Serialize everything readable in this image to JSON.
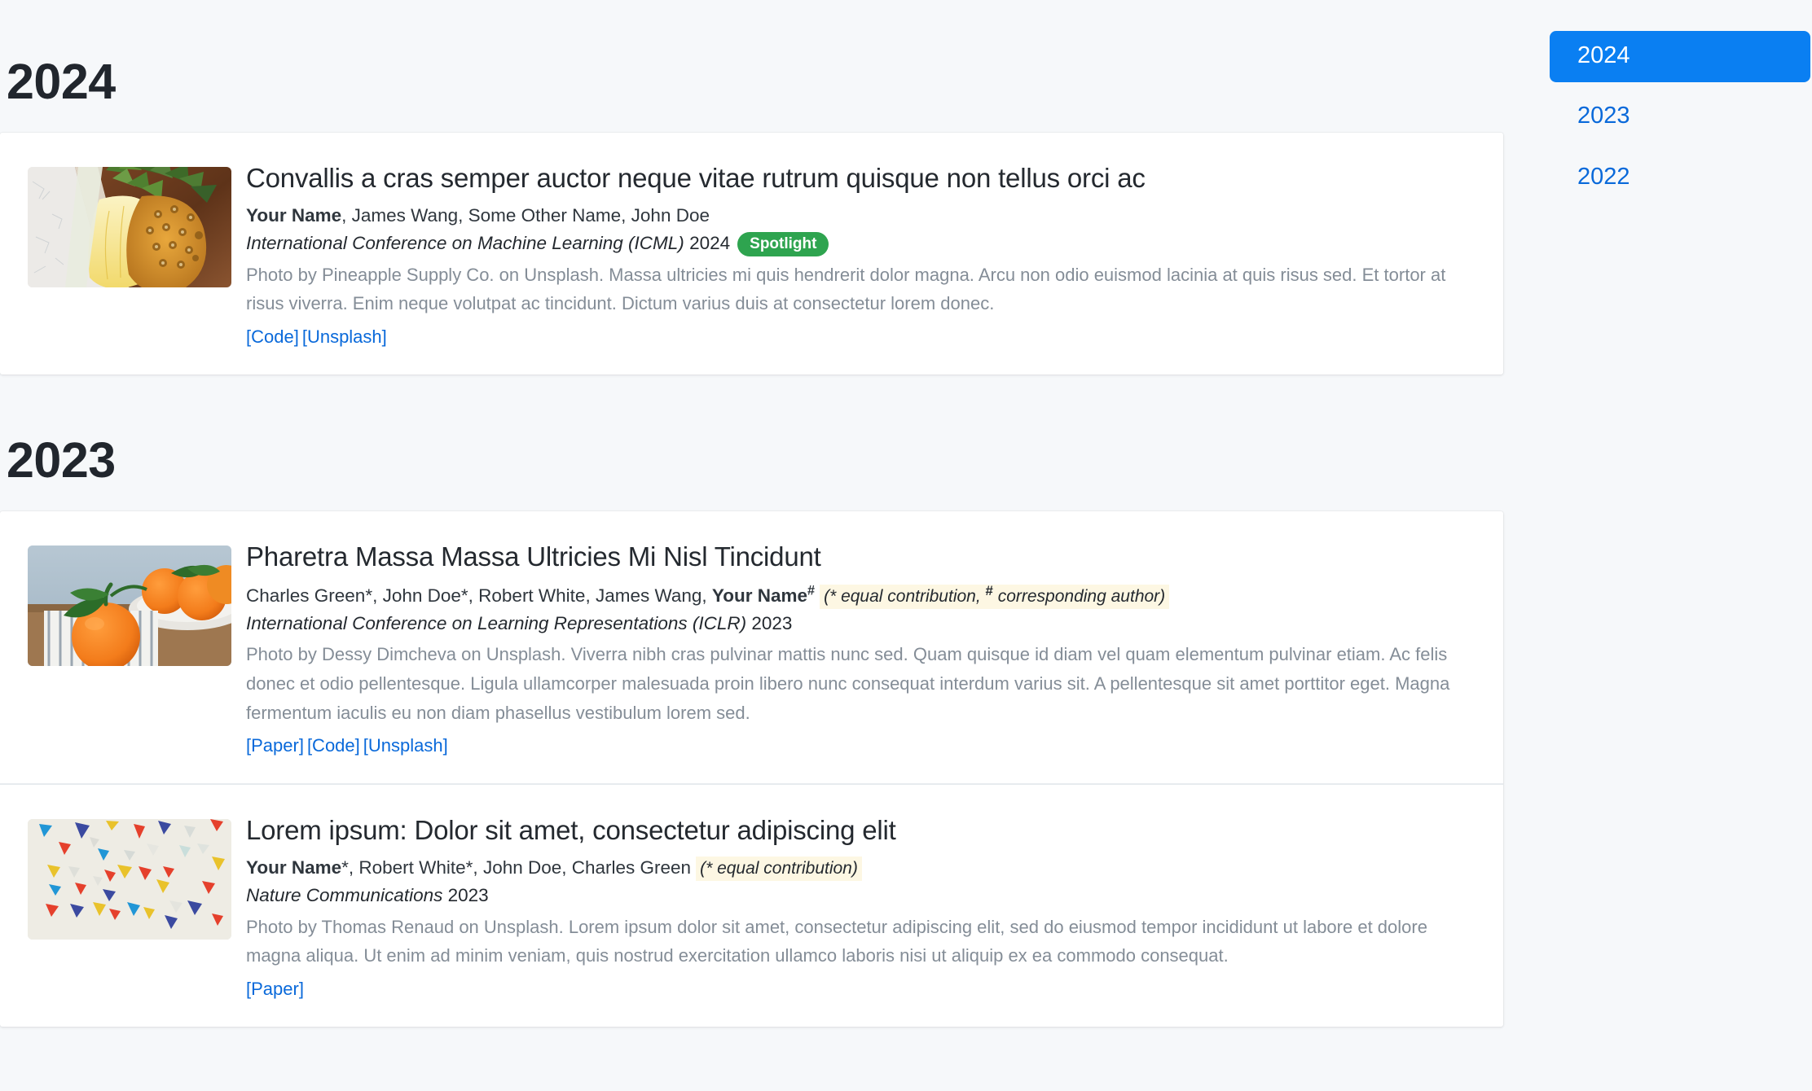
{
  "sidebar": {
    "items": [
      {
        "label": "2024",
        "active": true
      },
      {
        "label": "2023",
        "active": false
      },
      {
        "label": "2022",
        "active": false
      }
    ]
  },
  "sections": [
    {
      "year": "2024",
      "publications": [
        {
          "thumbnail": "pineapple-photo",
          "title": "Convallis a cras semper auctor neque vitae rutrum quisque non tellus orci ac",
          "authors_bold": "Your Name",
          "authors_rest": ", James Wang, Some Other Name, John Doe",
          "note": "",
          "venue": "International Conference on Machine Learning (ICML)",
          "venue_year": "2024",
          "badge": "Spotlight",
          "abstract": "Photo by Pineapple Supply Co. on Unsplash. Massa ultricies mi quis hendrerit dolor magna. Arcu non odio euismod lacinia at quis risus sed. Et tortor at risus viverra. Enim neque volutpat ac tincidunt. Dictum varius duis at consectetur lorem donec.",
          "links": [
            "[Code]",
            "[Unsplash]"
          ]
        }
      ]
    },
    {
      "year": "2023",
      "publications": [
        {
          "thumbnail": "oranges-photo",
          "title": "Pharetra Massa Massa Ultricies Mi Nisl Tincidunt",
          "authors_pre": "Charles Green*, John Doe*, Robert White, James Wang, ",
          "authors_bold": "Your Name",
          "authors_sup": "#",
          "note_a": "(* equal contribution, ",
          "note_sup": "#",
          "note_b": " corresponding author)",
          "venue": "International Conference on Learning Representations (ICLR)",
          "venue_year": "2023",
          "badge": "",
          "abstract": "Photo by Dessy Dimcheva on Unsplash. Viverra nibh cras pulvinar mattis nunc sed. Quam quisque id diam vel quam elementum pulvinar etiam. Ac felis donec et odio pellentesque. Ligula ullamcorper malesuada proin libero nunc consequat interdum varius sit. A pellentesque sit amet porttitor eget. Magna fermentum iaculis eu non diam phasellus vestibulum lorem sed.",
          "links": [
            "[Paper]",
            "[Code]",
            "[Unsplash]"
          ]
        },
        {
          "thumbnail": "confetti-triangles-photo",
          "title": "Lorem ipsum: Dolor sit amet, consectetur adipiscing elit",
          "authors_bold": "Your Name",
          "authors_rest": "*, Robert White*, John Doe, Charles Green",
          "note": "(* equal contribution)",
          "venue": "Nature Communications",
          "venue_year": "2023",
          "badge": "",
          "abstract": "Photo by Thomas Renaud on Unsplash. Lorem ipsum dolor sit amet, consectetur adipiscing elit, sed do eiusmod tempor incididunt ut labore et dolore magna aliqua. Ut enim ad minim veniam, quis nostrud exercitation ullamco laboris nisi ut aliquip ex ea commodo consequat.",
          "links": [
            "[Paper]"
          ]
        }
      ]
    }
  ],
  "colors": {
    "accent_link": "#0969da",
    "nav_active_bg": "#0a7ff2",
    "badge_green": "#2ea44f",
    "note_highlight": "#fdf7e3",
    "page_bg": "#f6f8fa",
    "muted_text": "#848d97"
  }
}
